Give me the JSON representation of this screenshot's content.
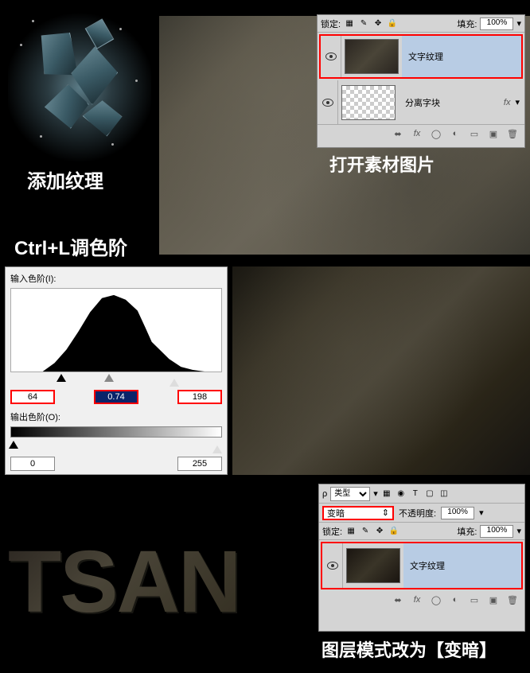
{
  "section1": {
    "caption_add_texture": "添加纹理",
    "caption_levels": "Ctrl+L调色阶",
    "caption_open_material": "打开素材图片"
  },
  "layers_panel1": {
    "lock_label": "锁定:",
    "fill_label": "填充:",
    "fill_value": "100%",
    "layers": [
      {
        "name": "文字纹理",
        "selected": true,
        "thumb": "texture"
      },
      {
        "name": "分离字块",
        "selected": false,
        "thumb": "checker",
        "fx": "fx"
      }
    ],
    "footer_icons": [
      "fx",
      "mask",
      "adjust",
      "group",
      "new",
      "trash"
    ]
  },
  "levels": {
    "input_label": "输入色阶(I):",
    "shadow": "64",
    "gamma": "0.74",
    "highlight": "198",
    "output_label": "输出色阶(O):",
    "out_low": "0",
    "out_high": "255"
  },
  "layers_panel2": {
    "type_label": "类型",
    "blend_mode": "变暗",
    "opacity_label": "不透明度:",
    "opacity_value": "100%",
    "lock_label": "锁定:",
    "fill_label": "填充:",
    "fill_value": "100%",
    "layers": [
      {
        "name": "文字纹理",
        "selected": true
      }
    ]
  },
  "section3": {
    "big_text": "TSAN",
    "caption_blend": "图层模式改为【变暗】"
  },
  "icons": {
    "type_glyphs": [
      "▦",
      "◉",
      "T",
      "▢",
      "◫"
    ],
    "lock_glyphs": [
      "▦",
      "✎",
      "✥",
      "🔒"
    ],
    "chevron": "▾",
    "link": "⬌"
  }
}
